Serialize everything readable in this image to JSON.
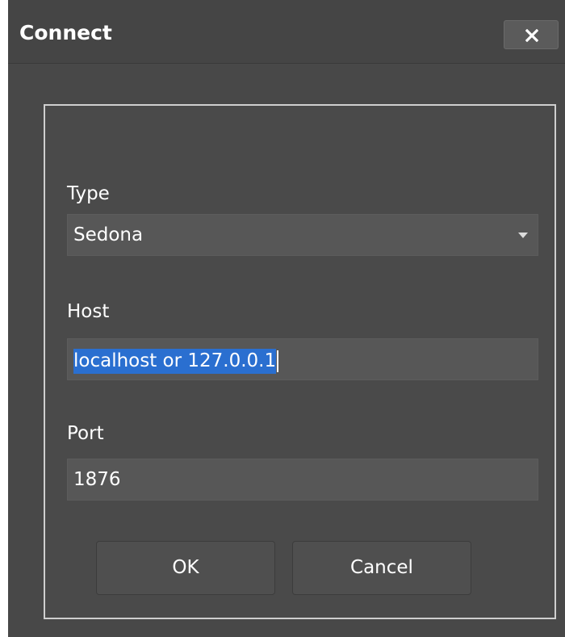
{
  "dialog": {
    "title": "Connect",
    "close_icon": "close-icon"
  },
  "form": {
    "type": {
      "label": "Type",
      "value": "Sedona",
      "arrow_icon": "chevron-down-icon"
    },
    "host": {
      "label": "Host",
      "value": "localhost or 127.0.0.1"
    },
    "port": {
      "label": "Port",
      "value": "1876"
    }
  },
  "buttons": {
    "ok_label": "OK",
    "cancel_label": "Cancel"
  },
  "colors": {
    "background": "#484848",
    "selection": "#2a6fd0",
    "panel_border": "#cfcfcf"
  }
}
